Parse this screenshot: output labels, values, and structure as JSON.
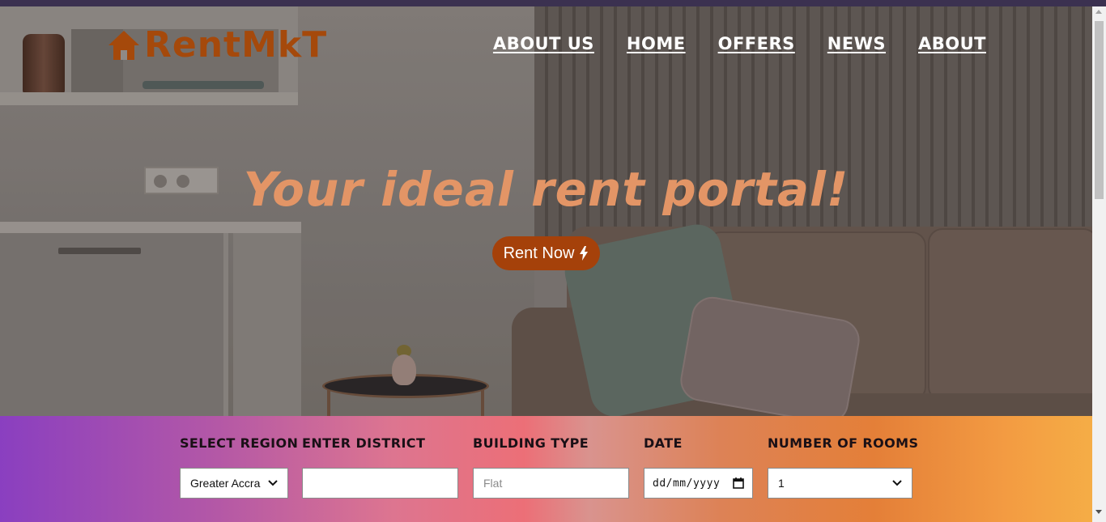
{
  "brand": {
    "name": "RentMkT",
    "color": "#a5490b"
  },
  "nav": {
    "items": [
      {
        "label": "ABOUT US"
      },
      {
        "label": "HOME"
      },
      {
        "label": "OFFERS"
      },
      {
        "label": "NEWS"
      },
      {
        "label": "ABOUT"
      }
    ]
  },
  "hero": {
    "headline": "Your ideal rent portal!",
    "headline_color": "#e39566",
    "cta_label": "Rent Now",
    "cta_icon": "lightning-bolt-icon",
    "cta_color": "#a5410a"
  },
  "search": {
    "region": {
      "label": "SELECT REGION",
      "value": "Greater Accra"
    },
    "district": {
      "label": "ENTER DISTRICT",
      "value": "",
      "placeholder": ""
    },
    "building": {
      "label": "BUILDING TYPE",
      "placeholder": "Flat"
    },
    "date": {
      "label": "DATE",
      "placeholder": "dd/mm/yyyy"
    },
    "rooms": {
      "label": "NUMBER OF ROOMS",
      "value": "1"
    }
  }
}
